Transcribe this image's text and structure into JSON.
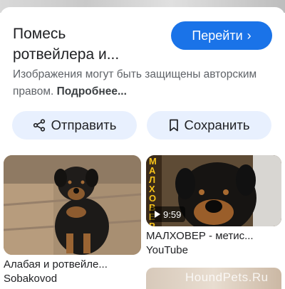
{
  "result": {
    "title": "Помесь\nротвейлера и...",
    "open_label": "Перейти",
    "open_chevron": "›",
    "notice_text": "Изображения могут быть защищены авторским правом. ",
    "notice_more": "Подробнее..."
  },
  "actions": {
    "share_label": "Отправить",
    "save_label": "Сохранить"
  },
  "related": [
    {
      "caption": "Алабая и ротвейле...",
      "source": "Sobakovod"
    },
    {
      "caption": "МАЛХОВЕР - метис...",
      "source": "YouTube",
      "duration": "9:59",
      "overlay_text": "МАЛХОВЕР"
    }
  ],
  "more": {
    "watermark": "HoundPets.Ru"
  },
  "colors": {
    "accent": "#1a73e8",
    "chip_bg": "#e8f0fe"
  }
}
